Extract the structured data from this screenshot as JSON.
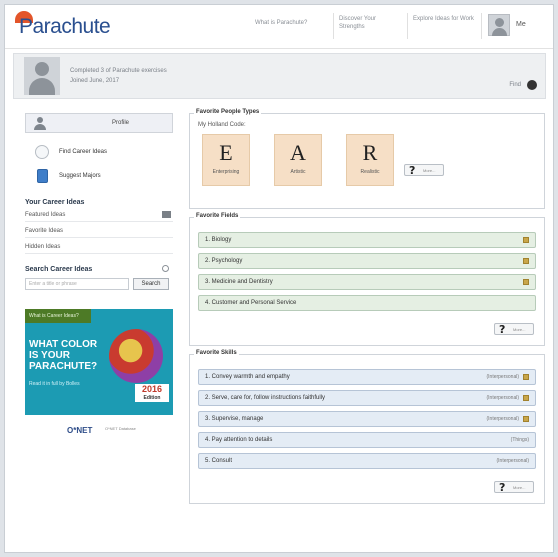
{
  "header": {
    "logo": "Parachute",
    "nav": [
      "What is Parachute?",
      "Discover Your Strengths",
      "Explore Ideas for Work"
    ],
    "me": "Me"
  },
  "banner": {
    "line1": "Completed 3 of Parachute exercises",
    "line2": "Joined June, 2017",
    "find": "Find"
  },
  "sidebar": {
    "profile": "Profile",
    "links": [
      "Find Career Ideas",
      "Suggest Majors"
    ],
    "career_heading": "Your Career Ideas",
    "career_items": [
      "Featured Ideas",
      "Favorite Ideas",
      "Hidden Ideas"
    ],
    "search_heading": "Search Career Ideas",
    "search_placeholder": "Enter a title or phrase",
    "search_button": "Search",
    "ad": {
      "top": "What is Career Ideas?",
      "title": "WHAT COLOR IS YOUR PARACHUTE?",
      "sub": "Read it in full by Bolles",
      "year": "2016",
      "edition": "Edition"
    },
    "onet": "O*NET",
    "onet_text": "O*NET Database"
  },
  "main": {
    "people_title": "Favorite People Types",
    "holland_label": "My Holland Code:",
    "letters": [
      {
        "letter": "E",
        "word": "Enterprising"
      },
      {
        "letter": "A",
        "word": "Artistic"
      },
      {
        "letter": "R",
        "word": "Realistic"
      }
    ],
    "more": "More...",
    "fields_title": "Favorite Fields",
    "fields": [
      "1. Biology",
      "2. Psychology",
      "3. Medicine and Dentistry",
      "4. Customer and Personal Service"
    ],
    "skills_title": "Favorite Skills",
    "skills": [
      {
        "label": "1. Convey warmth and empathy",
        "tag": "(Interpersonal)"
      },
      {
        "label": "2. Serve, care for, follow instructions faithfully",
        "tag": "(Interpersonal)"
      },
      {
        "label": "3. Supervise, manage",
        "tag": "(Interpersonal)"
      },
      {
        "label": "4. Pay attention to details",
        "tag": "(Things)"
      },
      {
        "label": "5. Consult",
        "tag": "(Interpersonal)"
      }
    ]
  }
}
